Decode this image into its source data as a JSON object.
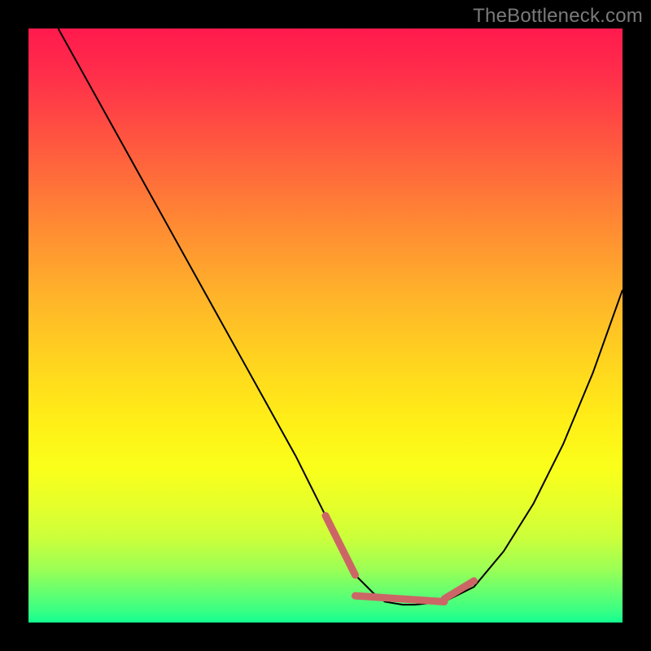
{
  "attribution": "TheBottleneck.com",
  "colors": {
    "background": "#000000",
    "curve": "#000000",
    "segment": "#cc6666",
    "attribution_text": "#7a7a7a"
  },
  "chart_data": {
    "type": "line",
    "title": "",
    "xlabel": "",
    "ylabel": "",
    "xlim": [
      0,
      100
    ],
    "ylim": [
      0,
      100
    ],
    "grid": false,
    "legend": false,
    "annotations": [],
    "series": [
      {
        "name": "curve",
        "x": [
          5,
          10,
          15,
          20,
          25,
          30,
          35,
          40,
          45,
          50,
          52,
          55,
          58,
          60,
          63,
          65,
          70,
          75,
          80,
          85,
          90,
          95,
          100
        ],
        "y": [
          100,
          91,
          82,
          73,
          64,
          55,
          46,
          37,
          28,
          18,
          13,
          8,
          5,
          3.5,
          3,
          3,
          3.5,
          6,
          12,
          20,
          30,
          42,
          56
        ]
      }
    ],
    "highlighted_segments": [
      {
        "x": [
          50,
          55
        ],
        "y": [
          18,
          8
        ]
      },
      {
        "x": [
          55,
          70
        ],
        "y": [
          4.5,
          3.5
        ]
      },
      {
        "x": [
          70,
          75
        ],
        "y": [
          4,
          7
        ]
      }
    ],
    "background_gradient": {
      "direction": "vertical",
      "stops": [
        {
          "pos": 0.0,
          "color": "#ff1a4d"
        },
        {
          "pos": 0.2,
          "color": "#ff5a3f"
        },
        {
          "pos": 0.45,
          "color": "#ffb32a"
        },
        {
          "pos": 0.66,
          "color": "#ffee17"
        },
        {
          "pos": 0.86,
          "color": "#caff3c"
        },
        {
          "pos": 1.0,
          "color": "#1fff90"
        }
      ]
    }
  }
}
